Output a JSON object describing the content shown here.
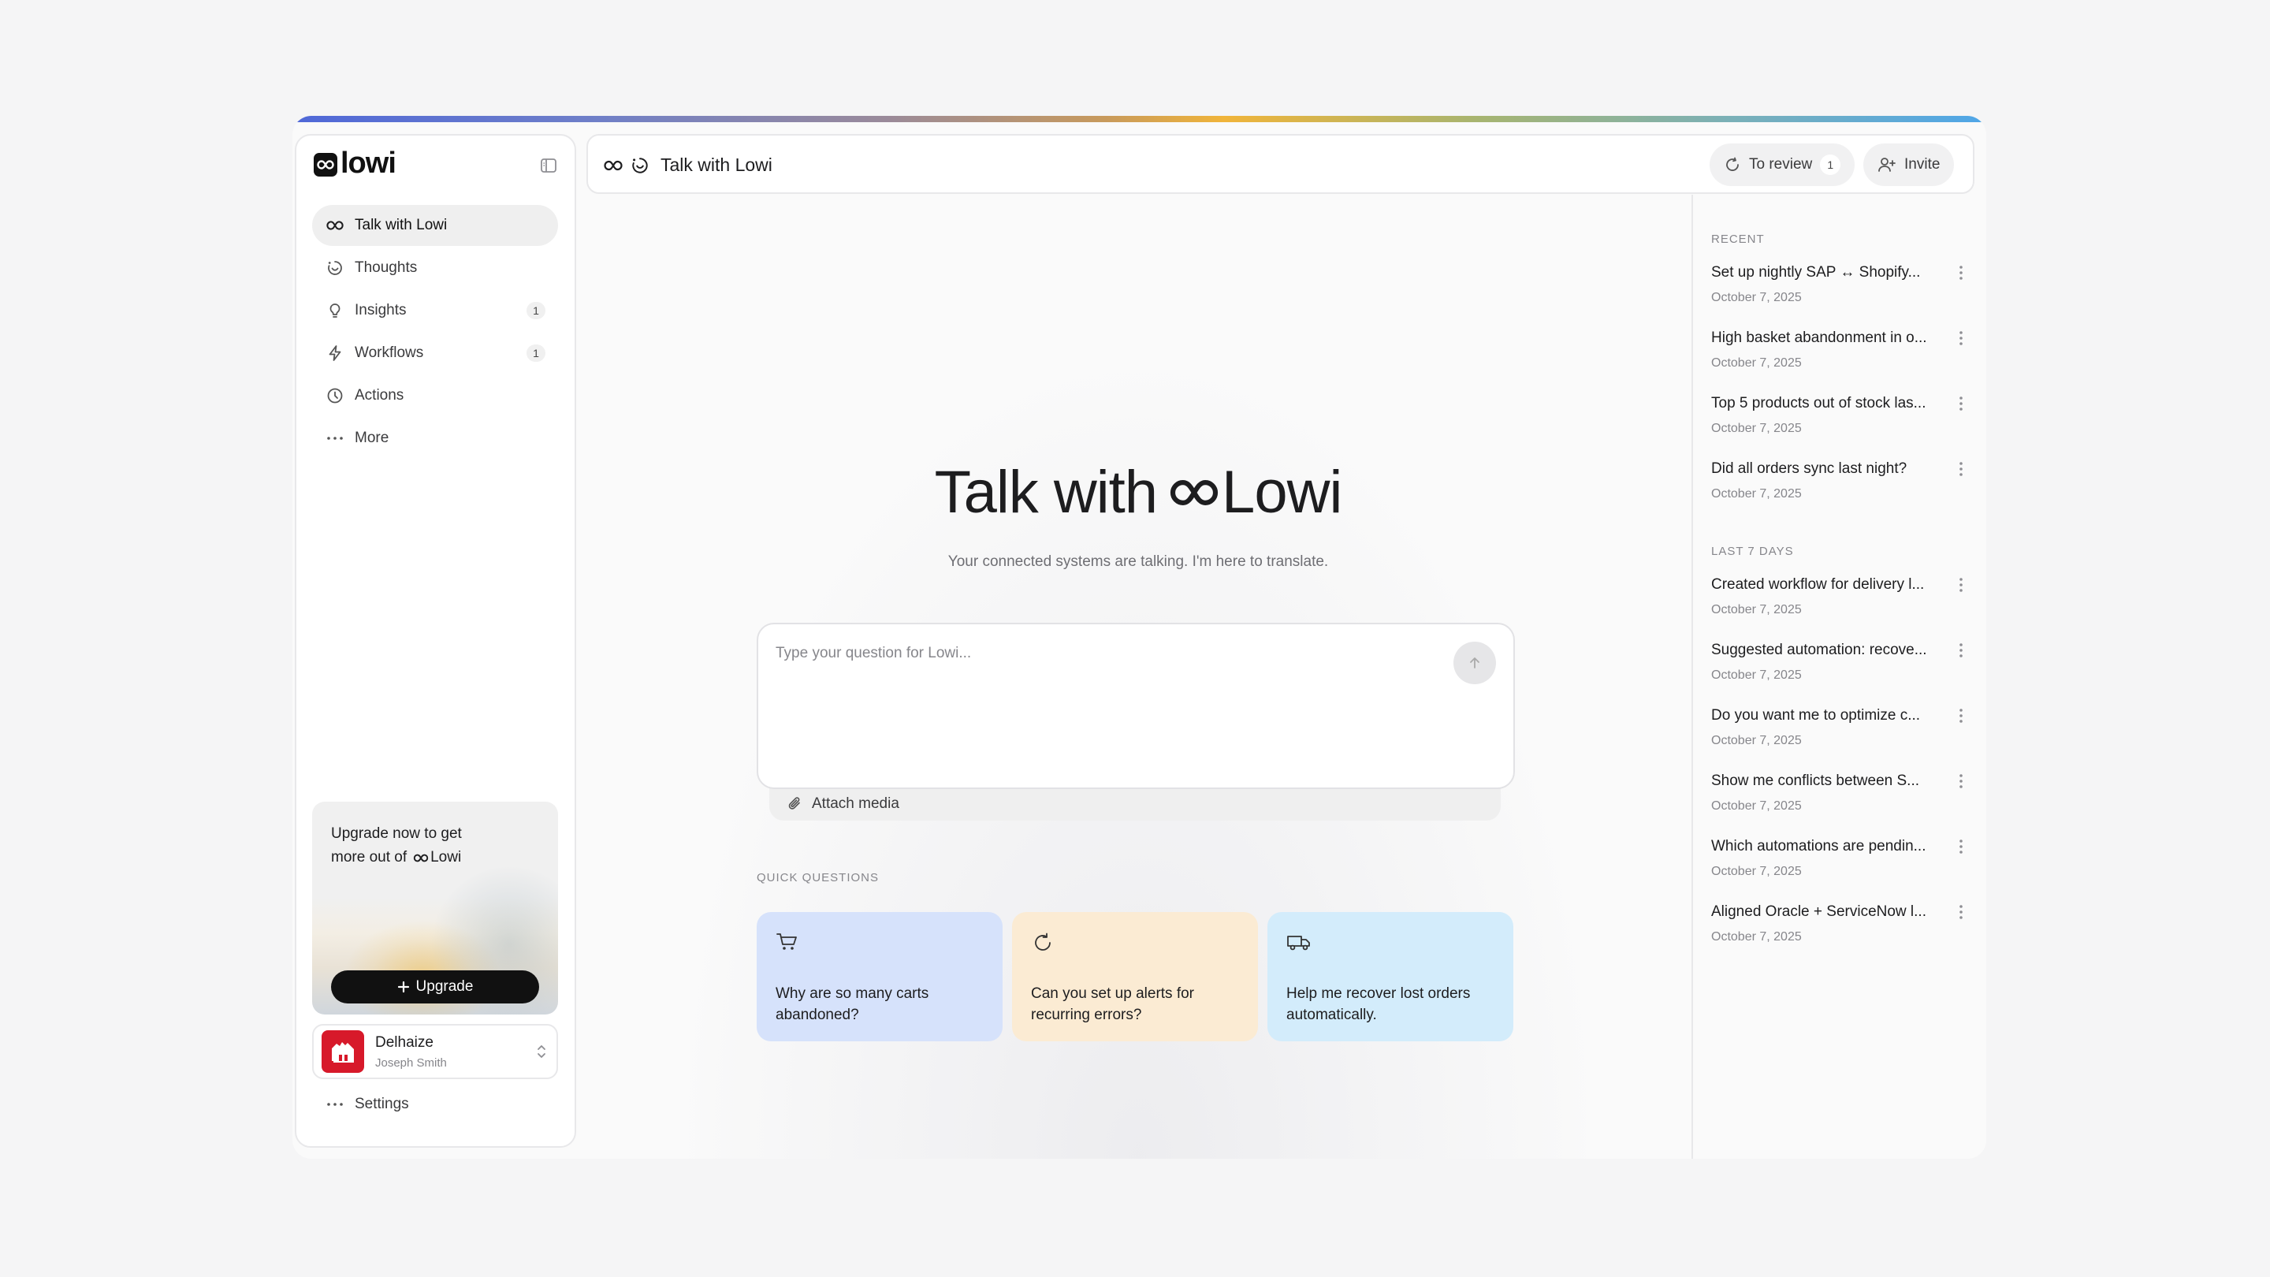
{
  "brand": {
    "logo_text": "lowi"
  },
  "sidebar": {
    "items": [
      {
        "label": "Talk with Lowi",
        "icon": "infinity-icon",
        "badge": ""
      },
      {
        "label": "Thoughts",
        "icon": "thoughts-icon",
        "badge": ""
      },
      {
        "label": "Insights",
        "icon": "lightbulb-icon",
        "badge": "1"
      },
      {
        "label": "Workflows",
        "icon": "bolt-icon",
        "badge": "1"
      },
      {
        "label": "Actions",
        "icon": "clock-icon",
        "badge": ""
      },
      {
        "label": "More",
        "icon": "more-dots-icon",
        "badge": ""
      }
    ],
    "upgrade": {
      "text_line1": "Upgrade now to get",
      "text_line2": "more out of",
      "brand": "Lowi",
      "button_label": "Upgrade"
    },
    "account": {
      "company": "Delhaize",
      "user": "Joseph Smith"
    },
    "settings_label": "Settings"
  },
  "header": {
    "title": "Talk with Lowi",
    "to_review_label": "To review",
    "to_review_count": "1",
    "invite_label": "Invite"
  },
  "main": {
    "hero_title_prefix": "Talk with",
    "hero_title_brand": "Lowi",
    "subtitle": "Your connected systems are talking. I'm here to translate.",
    "input_placeholder": "Type your question for Lowi...",
    "attach_label": "Attach media",
    "quick_questions_label": "QUICK QUESTIONS",
    "quick_questions": [
      {
        "text": "Why are so many carts abandoned?",
        "icon": "cart-icon",
        "color": "#d6e2fb"
      },
      {
        "text": "Can you set up alerts for recurring errors?",
        "icon": "refresh-icon",
        "color": "#fbebd3"
      },
      {
        "text": "Help me recover lost orders automatically.",
        "icon": "truck-icon",
        "color": "#d3ecfb"
      }
    ]
  },
  "history": {
    "recent_label": "RECENT",
    "recent": [
      {
        "title": "Set up nightly SAP ↔ Shopify...",
        "date": "October 7, 2025"
      },
      {
        "title": "High basket abandonment in o...",
        "date": "October 7, 2025"
      },
      {
        "title": "Top 5 products out of stock las...",
        "date": "October 7, 2025"
      },
      {
        "title": "Did all orders sync last night?",
        "date": "October 7, 2025"
      }
    ],
    "last7_label": "LAST 7 DAYS",
    "last7": [
      {
        "title": "Created workflow for delivery l...",
        "date": "October 7, 2025"
      },
      {
        "title": "Suggested automation: recove...",
        "date": "October 7, 2025"
      },
      {
        "title": "Do you want me to optimize c...",
        "date": "October 7, 2025"
      },
      {
        "title": "Show me conflicts between S...",
        "date": "October 7, 2025"
      },
      {
        "title": "Which automations are pendin...",
        "date": "October 7, 2025"
      },
      {
        "title": "Aligned Oracle + ServiceNow l...",
        "date": "October 7, 2025"
      }
    ]
  }
}
